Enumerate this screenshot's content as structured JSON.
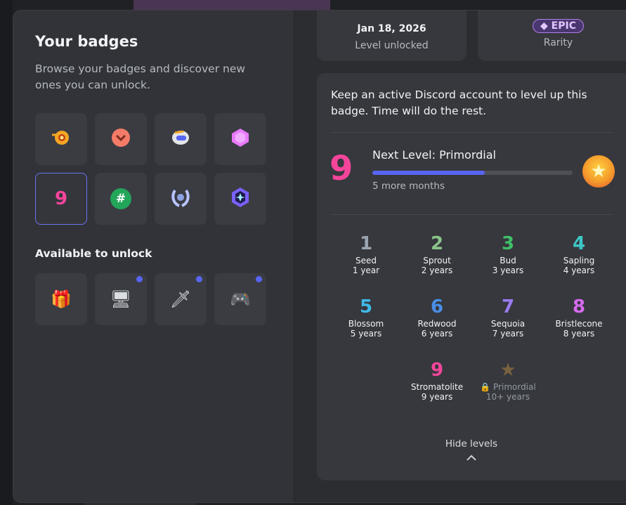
{
  "panel": {
    "title": "Your badges",
    "subtitle": "Browse your badges and discover new ones you can unlock.",
    "available_label": "Available to unlock"
  },
  "owned_badges": [
    {
      "icon": "orange-ring-badge-icon",
      "color": "#f5a623"
    },
    {
      "icon": "salmon-chevron-badge-icon",
      "color": "#f47b67"
    },
    {
      "icon": "robot-helmet-badge-icon",
      "color": "#f2f3f5"
    },
    {
      "icon": "pink-cube-badge-icon",
      "color": "#e879f9"
    },
    {
      "icon": "level-nine-badge-icon",
      "color": "#f5459b",
      "glyph": "9"
    },
    {
      "icon": "hashtag-badge-icon",
      "color": "#23a55a",
      "glyph": "#"
    },
    {
      "icon": "laurel-wreath-badge-icon",
      "color": "#b8c4ff"
    },
    {
      "icon": "star-gem-badge-icon",
      "color": "#7b61ff"
    }
  ],
  "unlockable_badges": [
    {
      "icon": "gift-icon",
      "glyph": "🎁"
    },
    {
      "icon": "monitor-icon",
      "glyph": "🖥"
    },
    {
      "icon": "sword-icon",
      "glyph": "🗡"
    },
    {
      "icon": "gamepad-icon",
      "glyph": "🎮"
    }
  ],
  "stats": {
    "date_value": "Jan 18, 2026",
    "date_label": "Level unlocked",
    "rarity_value": "◆ EPIC",
    "rarity_label": "Rarity"
  },
  "detail": {
    "description": "Keep an active Discord account to level up this badge. Time will do the rest.",
    "current_level_glyph": "9",
    "next_level": "Next Level: Primordial",
    "progress_percent": 56,
    "remaining": "5 more months",
    "next_glyph": "★",
    "hide_label": "Hide levels"
  },
  "levels": [
    {
      "glyph": "1",
      "name": "Seed",
      "years": "1 year",
      "color": "#9aa4b1"
    },
    {
      "glyph": "2",
      "name": "Sprout",
      "years": "2 years",
      "color": "#8bc48a"
    },
    {
      "glyph": "3",
      "name": "Bud",
      "years": "3 years",
      "color": "#3fbf6a"
    },
    {
      "glyph": "4",
      "name": "Sapling",
      "years": "4 years",
      "color": "#3fc7c7"
    },
    {
      "glyph": "5",
      "name": "Blossom",
      "years": "5 years",
      "color": "#3fb8e8"
    },
    {
      "glyph": "6",
      "name": "Redwood",
      "years": "6 years",
      "color": "#4a8ee8"
    },
    {
      "glyph": "7",
      "name": "Sequoia",
      "years": "7 years",
      "color": "#9a7bf0"
    },
    {
      "glyph": "8",
      "name": "Bristlecone",
      "years": "8 years",
      "color": "#d66af0"
    },
    {
      "glyph": "9",
      "name": "Stromatolite",
      "years": "9 years",
      "color": "#f5459b"
    },
    {
      "glyph": "★",
      "name": "🔒 Primordial",
      "years": "10+ years",
      "color": "#7a6240"
    }
  ]
}
